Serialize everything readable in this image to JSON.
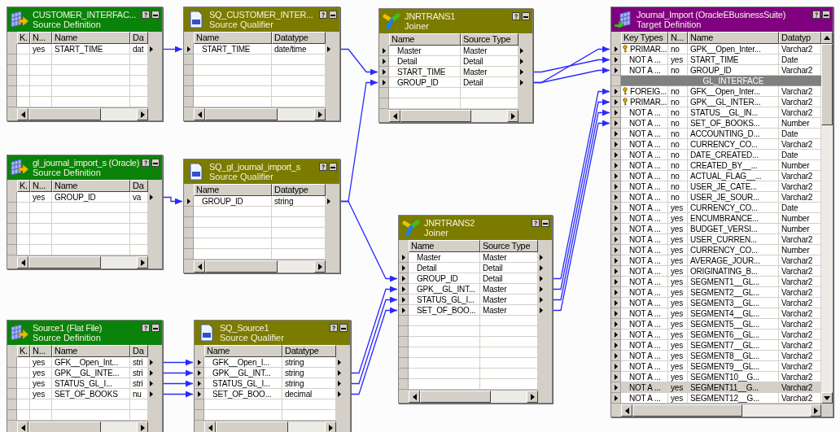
{
  "nodes": [
    {
      "kind": "source",
      "title": "CUSTOMER_INTERFAC...",
      "subtitle": "Source Definition",
      "columns": [
        "K.",
        "N...",
        "Name",
        "Da"
      ],
      "rows": [
        {
          "cells": [
            "",
            "yes",
            "START_TIME",
            "dat"
          ]
        }
      ]
    },
    {
      "kind": "qualifier",
      "title": "SQ_CUSTOMER_INTER...",
      "subtitle": "Source Qualifier",
      "columns": [
        "Name",
        "Datatype"
      ],
      "rows": [
        {
          "cells": [
            "START_TIME",
            "date/time"
          ]
        }
      ]
    },
    {
      "kind": "joiner",
      "title": "JNRTRANS1",
      "subtitle": "Joiner",
      "columns": [
        "Name",
        "Source Type"
      ],
      "rows": [
        {
          "cells": [
            "Master",
            "Master"
          ]
        },
        {
          "cells": [
            "Detail",
            "Detail"
          ]
        },
        {
          "cells": [
            "START_TIME",
            "Master"
          ]
        },
        {
          "cells": [
            "GROUP_ID",
            "Detail"
          ]
        }
      ]
    },
    {
      "kind": "target",
      "title": "Journal_Import (OracleEBusinessSuite)",
      "subtitle": "Target Definition",
      "columns": [
        "Key Types",
        "N...",
        "Name",
        "Datatyp"
      ],
      "rows": [
        {
          "key": true,
          "selected": false,
          "cells": [
            "PRIMAR...",
            "no",
            "GPK__Open_Inter...",
            "Varchar2"
          ]
        },
        {
          "key": false,
          "selected": false,
          "cells": [
            "NOT A ...",
            "yes",
            "START_TIME",
            "Date"
          ]
        },
        {
          "key": false,
          "selected": false,
          "cells": [
            "NOT A ...",
            "no",
            "GROUP_ID",
            "Varchar2"
          ]
        },
        {
          "kind": "group",
          "label": "GL_INTERFACE"
        },
        {
          "key": true,
          "selected": false,
          "cells": [
            "FOREIG...",
            "no",
            "GFK__Open_Inter...",
            "Varchar2"
          ]
        },
        {
          "key": true,
          "selected": false,
          "cells": [
            "PRIMAR...",
            "no",
            "GPK__GL_INTER...",
            "Varchar2"
          ]
        },
        {
          "key": false,
          "selected": false,
          "cells": [
            "NOT A ...",
            "no",
            "STATUS__GL_IN...",
            "Varchar2"
          ]
        },
        {
          "key": false,
          "selected": false,
          "cells": [
            "NOT A ...",
            "no",
            "SET_OF_BOOKS...",
            "Number"
          ]
        },
        {
          "key": false,
          "selected": false,
          "cells": [
            "NOT A ...",
            "no",
            "ACCOUNTING_D...",
            "Date"
          ]
        },
        {
          "key": false,
          "selected": false,
          "cells": [
            "NOT A ...",
            "no",
            "CURRENCY_CO...",
            "Varchar2"
          ]
        },
        {
          "key": false,
          "selected": false,
          "cells": [
            "NOT A ...",
            "no",
            "DATE_CREATED...",
            "Date"
          ]
        },
        {
          "key": false,
          "selected": false,
          "cells": [
            "NOT A ...",
            "no",
            "CREATED_BY__...",
            "Number"
          ]
        },
        {
          "key": false,
          "selected": false,
          "cells": [
            "NOT A ...",
            "no",
            "ACTUAL_FLAG__...",
            "Varchar2"
          ]
        },
        {
          "key": false,
          "selected": false,
          "cells": [
            "NOT A ...",
            "no",
            "USER_JE_CATE...",
            "Varchar2"
          ]
        },
        {
          "key": false,
          "selected": false,
          "cells": [
            "NOT A ...",
            "no",
            "USER_JE_SOUR...",
            "Varchar2"
          ]
        },
        {
          "key": false,
          "selected": false,
          "cells": [
            "NOT A ...",
            "yes",
            "CURRENCY_CO...",
            "Date"
          ]
        },
        {
          "key": false,
          "selected": false,
          "cells": [
            "NOT A ...",
            "yes",
            "ENCUMBRANCE...",
            "Number"
          ]
        },
        {
          "key": false,
          "selected": false,
          "cells": [
            "NOT A ...",
            "yes",
            "BUDGET_VERSI...",
            "Number"
          ]
        },
        {
          "key": false,
          "selected": false,
          "cells": [
            "NOT A ...",
            "yes",
            "USER_CURREN...",
            "Varchar2"
          ]
        },
        {
          "key": false,
          "selected": false,
          "cells": [
            "NOT A ...",
            "yes",
            "CURRENCY_CO...",
            "Number"
          ]
        },
        {
          "key": false,
          "selected": false,
          "cells": [
            "NOT A ...",
            "yes",
            "AVERAGE_JOUR...",
            "Varchar2"
          ]
        },
        {
          "key": false,
          "selected": false,
          "cells": [
            "NOT A ...",
            "yes",
            "ORIGINATING_B...",
            "Varchar2"
          ]
        },
        {
          "key": false,
          "selected": false,
          "cells": [
            "NOT A ...",
            "yes",
            "SEGMENT1__GL...",
            "Varchar2"
          ]
        },
        {
          "key": false,
          "selected": false,
          "cells": [
            "NOT A ...",
            "yes",
            "SEGMENT2__GL...",
            "Varchar2"
          ]
        },
        {
          "key": false,
          "selected": false,
          "cells": [
            "NOT A ...",
            "yes",
            "SEGMENT3__GL...",
            "Varchar2"
          ]
        },
        {
          "key": false,
          "selected": false,
          "cells": [
            "NOT A ...",
            "yes",
            "SEGMENT4__GL...",
            "Varchar2"
          ]
        },
        {
          "key": false,
          "selected": false,
          "cells": [
            "NOT A ...",
            "yes",
            "SEGMENT5__GL...",
            "Varchar2"
          ]
        },
        {
          "key": false,
          "selected": false,
          "cells": [
            "NOT A ...",
            "yes",
            "SEGMENT6__GL...",
            "Varchar2"
          ]
        },
        {
          "key": false,
          "selected": false,
          "cells": [
            "NOT A ...",
            "yes",
            "SEGMENT7__GL...",
            "Varchar2"
          ]
        },
        {
          "key": false,
          "selected": false,
          "cells": [
            "NOT A ...",
            "yes",
            "SEGMENT8__GL...",
            "Varchar2"
          ]
        },
        {
          "key": false,
          "selected": false,
          "cells": [
            "NOT A ...",
            "yes",
            "SEGMENT9__GL...",
            "Varchar2"
          ]
        },
        {
          "key": false,
          "selected": false,
          "cells": [
            "NOT A ...",
            "yes",
            "SEGMENT10__G...",
            "Varchar2"
          ]
        },
        {
          "key": false,
          "selected": true,
          "cells": [
            "NOT A ...",
            "yes",
            "SEGMENT11__G...",
            "Varchar2"
          ]
        },
        {
          "key": false,
          "selected": false,
          "cells": [
            "NOT A ...",
            "yes",
            "SEGMENT12__G...",
            "Varchar2"
          ]
        }
      ]
    },
    {
      "kind": "source",
      "title": "gl_journal_import_s (Oracle)",
      "subtitle": "Source Definition",
      "columns": [
        "K.",
        "N...",
        "Name",
        "Da"
      ],
      "rows": [
        {
          "cells": [
            "",
            "yes",
            "GROUP_ID",
            "va"
          ]
        }
      ]
    },
    {
      "kind": "qualifier",
      "title": "SQ_gl_journal_import_s",
      "subtitle": "Source Qualifier",
      "columns": [
        "Name",
        "Datatype"
      ],
      "rows": [
        {
          "cells": [
            "GROUP_ID",
            "string"
          ]
        }
      ]
    },
    {
      "kind": "joiner",
      "title": "JNRTRANS2",
      "subtitle": "Joiner",
      "columns": [
        "Name",
        "Source Type"
      ],
      "rows": [
        {
          "cells": [
            "Master",
            "Master"
          ]
        },
        {
          "cells": [
            "Detail",
            "Detail"
          ]
        },
        {
          "cells": [
            "GROUP_ID",
            "Detail"
          ]
        },
        {
          "cells": [
            "GPK__GL_INT...",
            "Master"
          ]
        },
        {
          "cells": [
            "STATUS_GL_I...",
            "Master"
          ]
        },
        {
          "cells": [
            "SET_OF_BOO...",
            "Master"
          ]
        }
      ]
    },
    {
      "kind": "source",
      "title": "Source1 (Flat File)",
      "subtitle": "Source Definition",
      "columns": [
        "K.",
        "N...",
        "Name",
        "Da"
      ],
      "rows": [
        {
          "cells": [
            "",
            "yes",
            "GFK__Open_Int...",
            "stri"
          ]
        },
        {
          "cells": [
            "",
            "yes",
            "GPK__GL_INTE...",
            "stri"
          ]
        },
        {
          "cells": [
            "",
            "yes",
            "STATUS_GL_I...",
            "stri"
          ]
        },
        {
          "cells": [
            "",
            "yes",
            "SET_OF_BOOKS",
            "nu"
          ]
        }
      ]
    },
    {
      "kind": "qualifier",
      "title": "SQ_Source1",
      "subtitle": "Source Qualifier",
      "columns": [
        "Name",
        "Datatype"
      ],
      "rows": [
        {
          "cells": [
            "GFK__Open_I...",
            "string"
          ]
        },
        {
          "cells": [
            "GPK__GL_INT...",
            "string"
          ]
        },
        {
          "cells": [
            "STATUS_GL_I...",
            "string"
          ]
        },
        {
          "cells": [
            "SET_OF_BOO...",
            "decimal"
          ]
        }
      ]
    }
  ]
}
